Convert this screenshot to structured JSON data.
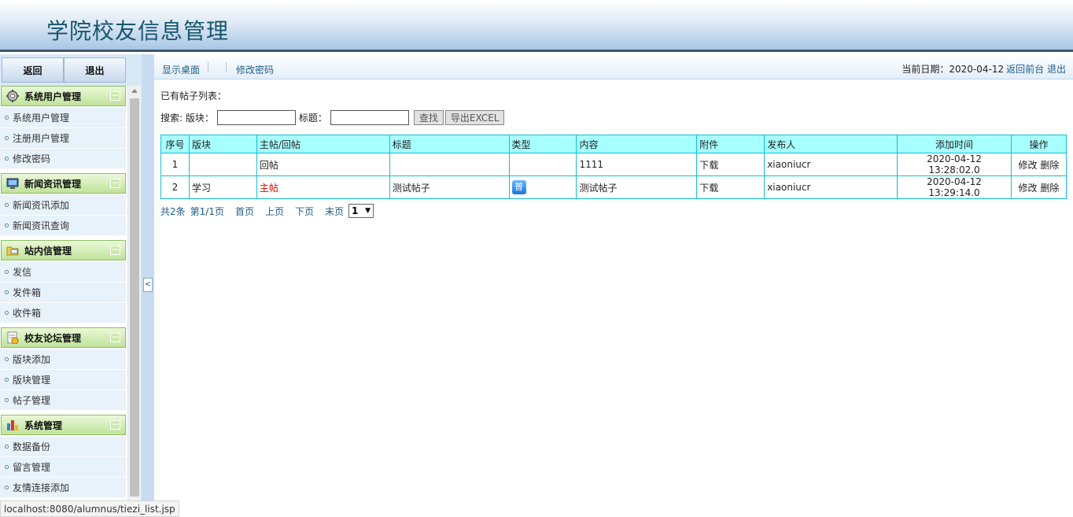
{
  "header": {
    "title": "学院校友信息管理"
  },
  "sidebar": {
    "buttons": {
      "back": "返回",
      "logout": "退出"
    },
    "groups": [
      {
        "title": "系统用户管理",
        "icon": "gear-icon",
        "items": [
          "系统用户管理",
          "注册用户管理",
          "修改密码"
        ]
      },
      {
        "title": "新闻资讯管理",
        "icon": "monitor-icon",
        "items": [
          "新闻资讯添加",
          "新闻资讯查询"
        ]
      },
      {
        "title": "站内信管理",
        "icon": "folder-mail-icon",
        "items": [
          "发信",
          "发件箱",
          "收件箱"
        ]
      },
      {
        "title": "校友论坛管理",
        "icon": "forum-icon",
        "items": [
          "版块添加",
          "版块管理",
          "帖子管理"
        ]
      },
      {
        "title": "系统管理",
        "icon": "bar-chart-icon",
        "items": [
          "数据备份",
          "留言管理",
          "友情连接添加"
        ]
      }
    ],
    "toggle_symbol": "−",
    "collapse_symbol": "<"
  },
  "topbar": {
    "links": [
      "显示桌面",
      "修改密码"
    ],
    "date_label": "当前日期：",
    "date_value": "2020-04-12",
    "front_link": "返回前台",
    "logout_link": "退出"
  },
  "main": {
    "caption": "已有帖子列表：",
    "search": {
      "label": "搜索: 版块：",
      "title_label": "标题：",
      "search_btn": "查找",
      "export_btn": "导出EXCEL"
    },
    "table": {
      "headers": [
        "序号",
        "版块",
        "主帖/回帖",
        "标题",
        "类型",
        "内容",
        "附件",
        "发布人",
        "添加时间",
        "操作"
      ],
      "rows": [
        {
          "no": "1",
          "board": "",
          "kind": "回帖",
          "title": "",
          "type_badge": "",
          "content": "1111",
          "attachment": "下载",
          "author": "xiaoniucr",
          "time": "2020-04-12 13:28:02.0",
          "edit": "修改",
          "delete": "删除"
        },
        {
          "no": "2",
          "board": "学习",
          "kind": "主帖",
          "title": "测试帖子",
          "type_badge": "普",
          "content": "测试帖子",
          "attachment": "下载",
          "author": "xiaoniucr",
          "time": "2020-04-12 13:29:14.0",
          "edit": "修改",
          "delete": "删除"
        }
      ]
    },
    "pager": {
      "total": "共2条",
      "page_info": "第1/1页",
      "first": "首页",
      "prev": "上页",
      "next": "下页",
      "last": "末页",
      "current": "1"
    }
  },
  "status_url": "localhost:8080/alumnus/tiezi_list.jsp",
  "colors": {
    "header_title": "#17566d",
    "group_head": "#bfe39a",
    "table_header": "#a8ffff",
    "table_border": "#11bfd6",
    "link": "#1c5d8c",
    "main_post": "#e30000"
  }
}
